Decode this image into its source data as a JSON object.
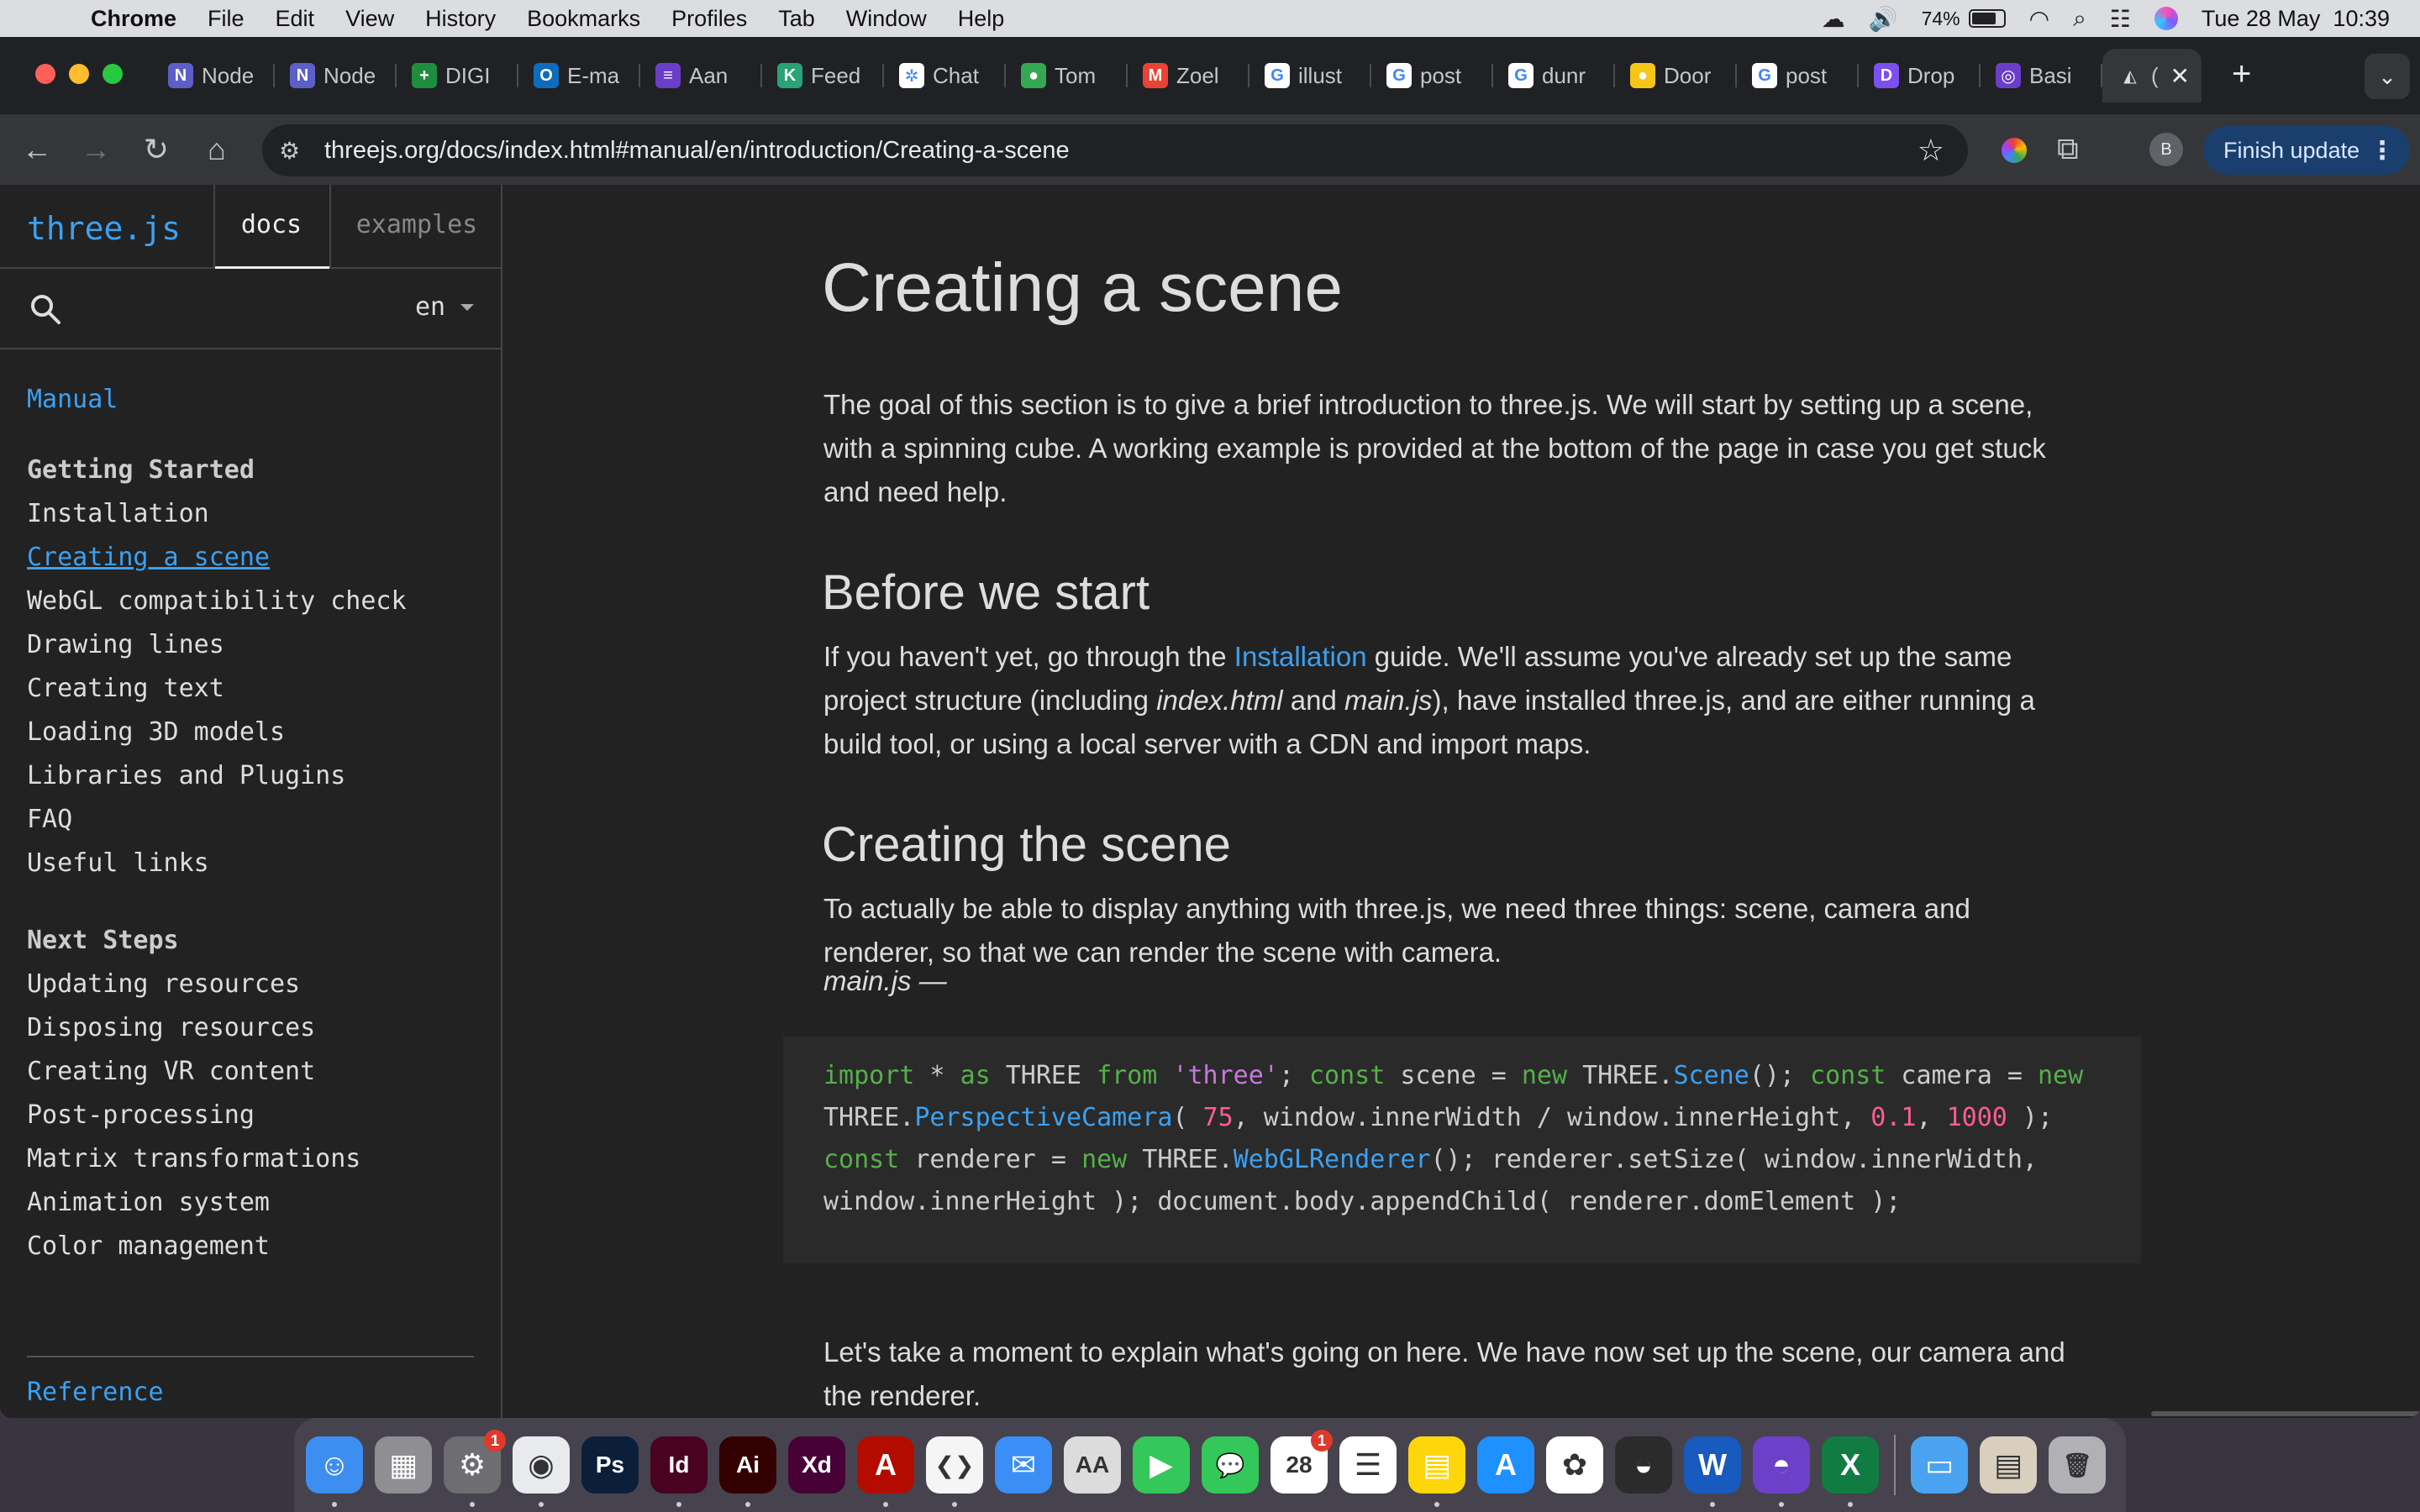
{
  "menubar": {
    "app_name": "Chrome",
    "menus": [
      "File",
      "Edit",
      "View",
      "History",
      "Bookmarks",
      "Profiles",
      "Tab",
      "Window",
      "Help"
    ],
    "battery": "74%",
    "datetime": "Tue 28 May  10:39"
  },
  "tabs": [
    {
      "label": "Node",
      "icon": "notion-like-icon",
      "color": "#5b5fc7",
      "glyph": "N"
    },
    {
      "label": "Node",
      "icon": "notion-like-icon",
      "color": "#5b5fc7",
      "glyph": "N"
    },
    {
      "label": "DIGI",
      "icon": "sheets-icon",
      "color": "#1e8e3e",
      "glyph": "+"
    },
    {
      "label": "E-ma",
      "icon": "outlook-icon",
      "color": "#0f6cbd",
      "glyph": "O"
    },
    {
      "label": "Aan",
      "icon": "forms-icon",
      "color": "#6a3ec8",
      "glyph": "≡"
    },
    {
      "label": "Feed",
      "icon": "feedback-icon",
      "color": "#27a376",
      "glyph": "K"
    },
    {
      "label": "Chat",
      "icon": "chatgpt-icon",
      "color": "#ffffff",
      "glyph": "✲"
    },
    {
      "label": "Tom",
      "icon": "maps-pin-icon",
      "color": "#34a853",
      "glyph": "●"
    },
    {
      "label": "Zoel",
      "icon": "gmail-icon",
      "color": "#ea4335",
      "glyph": "M"
    },
    {
      "label": "illust",
      "icon": "google-icon",
      "color": "#ffffff",
      "glyph": "G"
    },
    {
      "label": "post",
      "icon": "google-icon",
      "color": "#ffffff",
      "glyph": "G"
    },
    {
      "label": "dunr",
      "icon": "google-icon",
      "color": "#ffffff",
      "glyph": "G"
    },
    {
      "label": "Door",
      "icon": "circle-icon",
      "color": "#f5c518",
      "glyph": "●"
    },
    {
      "label": "post",
      "icon": "google-icon",
      "color": "#ffffff",
      "glyph": "G"
    },
    {
      "label": "Drop",
      "icon": "drop-icon",
      "color": "#7b4ff0",
      "glyph": "D"
    },
    {
      "label": "Basi",
      "icon": "basic-icon",
      "color": "#6a3ec8",
      "glyph": "◎"
    }
  ],
  "active_tab": {
    "label": "(",
    "icon": "threejs-icon"
  },
  "toolbar": {
    "url": "threejs.org/docs/index.html#manual/en/introduction/Creating-a-scene",
    "profile_initial": "B",
    "finish_update": "Finish update"
  },
  "sidebar": {
    "logo": "three.js",
    "tab_docs": "docs",
    "tab_examples": "examples",
    "lang": "en",
    "section_manual": "Manual",
    "group_getting_started": "Getting Started",
    "getting_started": [
      "Installation",
      "Creating a scene",
      "WebGL compatibility check",
      "Drawing lines",
      "Creating text",
      "Loading 3D models",
      "Libraries and Plugins",
      "FAQ",
      "Useful links"
    ],
    "group_next_steps": "Next Steps",
    "next_steps": [
      "Updating resources",
      "Disposing resources",
      "Creating VR content",
      "Post-processing",
      "Matrix transformations",
      "Animation system",
      "Color management"
    ],
    "reference": "Reference"
  },
  "content": {
    "title": "Creating a scene",
    "intro": "The goal of this section is to give a brief introduction to three.js. We will start by setting up a scene, with a spinning cube. A working example is provided at the bottom of the page in case you get stuck and need help.",
    "h_before": "Before we start",
    "before_1": "If you haven't yet, go through the ",
    "before_link": "Installation",
    "before_2": " guide. We'll assume you've already set up the same project structure (including ",
    "before_em1": "index.html",
    "before_3": " and ",
    "before_em2": "main.js",
    "before_4": "), have installed three.js, and are either running a build tool, or using a local server with a CDN and import maps.",
    "h_creating": "Creating the scene",
    "creating_p": "To actually be able to display anything with three.js, we need three things: scene, camera and renderer, so that we can render the scene with camera.",
    "file_label": "main.js —",
    "code_line1": [
      {
        "t": "import",
        "c": "kw"
      },
      {
        "t": " * ",
        "c": ""
      },
      {
        "t": "as",
        "c": "kw"
      },
      {
        "t": " THREE ",
        "c": ""
      },
      {
        "t": "from",
        "c": "kw"
      },
      {
        "t": " ",
        "c": ""
      },
      {
        "t": "'three'",
        "c": "str"
      },
      {
        "t": "; ",
        "c": ""
      },
      {
        "t": "const",
        "c": "kw"
      },
      {
        "t": " scene = ",
        "c": ""
      },
      {
        "t": "new",
        "c": "kw"
      },
      {
        "t": " THREE.",
        "c": ""
      },
      {
        "t": "Scene",
        "c": "cls"
      },
      {
        "t": "(); ",
        "c": ""
      },
      {
        "t": "const",
        "c": "kw"
      },
      {
        "t": " camera = ",
        "c": ""
      },
      {
        "t": "new",
        "c": "kw"
      }
    ],
    "code_line2": [
      {
        "t": "THREE.",
        "c": ""
      },
      {
        "t": "PerspectiveCamera",
        "c": "cls"
      },
      {
        "t": "( ",
        "c": ""
      },
      {
        "t": "75",
        "c": "num"
      },
      {
        "t": ", window.innerWidth / window.innerHeight, ",
        "c": ""
      },
      {
        "t": "0.1",
        "c": "num"
      },
      {
        "t": ", ",
        "c": ""
      },
      {
        "t": "1000",
        "c": "num"
      },
      {
        "t": " );",
        "c": ""
      }
    ],
    "code_line3": [
      {
        "t": "const",
        "c": "kw"
      },
      {
        "t": " renderer = ",
        "c": ""
      },
      {
        "t": "new",
        "c": "kw"
      },
      {
        "t": " THREE.",
        "c": ""
      },
      {
        "t": "WebGLRenderer",
        "c": "cls"
      },
      {
        "t": "(); renderer.setSize( window.innerWidth,",
        "c": ""
      }
    ],
    "code_line4": [
      {
        "t": "window.innerHeight ); document.body.appendChild( renderer.domElement );",
        "c": ""
      }
    ],
    "explain": "Let's take a moment to explain what's going on here. We have now set up the scene, our camera and the renderer."
  },
  "dock": {
    "apps": [
      {
        "name": "finder",
        "glyph": "☺",
        "color": "#3d8ef0",
        "running": true
      },
      {
        "name": "launchpad",
        "glyph": "▦",
        "color": "#8e8e93",
        "running": false
      },
      {
        "name": "system-settings",
        "glyph": "⚙",
        "color": "#6d6d72",
        "running": true,
        "badge": "1"
      },
      {
        "name": "chrome",
        "glyph": "◉",
        "color": "#e8eaed",
        "running": true
      },
      {
        "name": "photoshop",
        "glyph": "Ps",
        "color": "#0b1f3a",
        "running": false
      },
      {
        "name": "indesign",
        "glyph": "Id",
        "color": "#49021f",
        "running": true
      },
      {
        "name": "illustrator",
        "glyph": "Ai",
        "color": "#330000",
        "running": true
      },
      {
        "name": "xd",
        "glyph": "Xd",
        "color": "#470137",
        "running": false
      },
      {
        "name": "acrobat",
        "glyph": "A",
        "color": "#b30b00",
        "running": true
      },
      {
        "name": "vscode",
        "glyph": "❮❯",
        "color": "#f5f5f5",
        "running": true
      },
      {
        "name": "mail",
        "glyph": "✉",
        "color": "#3a8ef5",
        "running": false
      },
      {
        "name": "font-book",
        "glyph": "AA",
        "color": "#dcdcdc",
        "running": false
      },
      {
        "name": "facetime",
        "glyph": "▶",
        "color": "#34c759",
        "running": false
      },
      {
        "name": "messages",
        "glyph": "💬",
        "color": "#34c759",
        "running": false
      },
      {
        "name": "calendar",
        "glyph": "28",
        "color": "#ffffff",
        "running": false,
        "badge": "1"
      },
      {
        "name": "reminders",
        "glyph": "☰",
        "color": "#ffffff",
        "running": false
      },
      {
        "name": "notes",
        "glyph": "▤",
        "color": "#ffd60a",
        "running": true
      },
      {
        "name": "app-store",
        "glyph": "A",
        "color": "#1e90ff",
        "running": false
      },
      {
        "name": "photos",
        "glyph": "✿",
        "color": "#ffffff",
        "running": false
      },
      {
        "name": "blender",
        "glyph": "◒",
        "color": "#2b2b2b",
        "running": false
      },
      {
        "name": "word",
        "glyph": "W",
        "color": "#185abd",
        "running": true
      },
      {
        "name": "github-desktop",
        "glyph": "◓",
        "color": "#6e40c9",
        "running": true
      },
      {
        "name": "excel",
        "glyph": "X",
        "color": "#107c41",
        "running": true
      }
    ],
    "right": [
      {
        "name": "downloads-folder",
        "glyph": "▭",
        "color": "#4aa3f0"
      },
      {
        "name": "document-stack",
        "glyph": "▤",
        "color": "#d8cfbf"
      },
      {
        "name": "trash",
        "glyph": "🗑",
        "color": "#b0b0b5"
      }
    ]
  }
}
